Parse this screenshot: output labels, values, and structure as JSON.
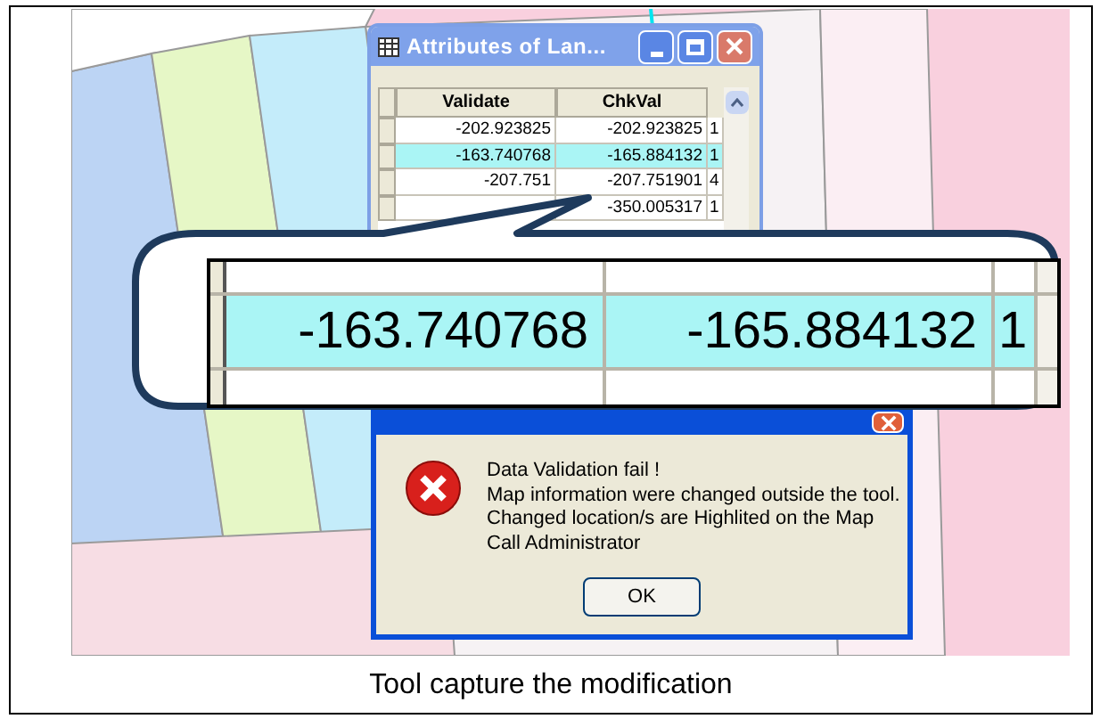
{
  "attributes_window": {
    "title": "Attributes of Lan...",
    "columns": [
      "Validate",
      "ChkVal"
    ],
    "rows": [
      {
        "validate": "-202.923825",
        "chkval": "-202.923825",
        "column_3": "1",
        "selected": false
      },
      {
        "validate": "-163.740768",
        "chkval": "-165.884132",
        "column_3": "1",
        "selected": true
      },
      {
        "validate": "-207.751",
        "chkval": "-207.751901",
        "column_3": "4",
        "selected": false
      },
      {
        "chkval": "-350.005317",
        "column_3": "1",
        "selected": false
      }
    ]
  },
  "magnifier": {
    "rows": [
      {
        "validate": "-163.740768",
        "chkval": "-165.884132",
        "column_3": "1",
        "selected": true
      }
    ]
  },
  "error_dialog": {
    "message_lines": [
      "Data Validation fail !",
      "Map information were changed outside the tool.",
      "Changed location/s are Highlited on the Map",
      "Call Administrator"
    ],
    "button": "OK"
  },
  "caption": "Tool capture the modification"
}
